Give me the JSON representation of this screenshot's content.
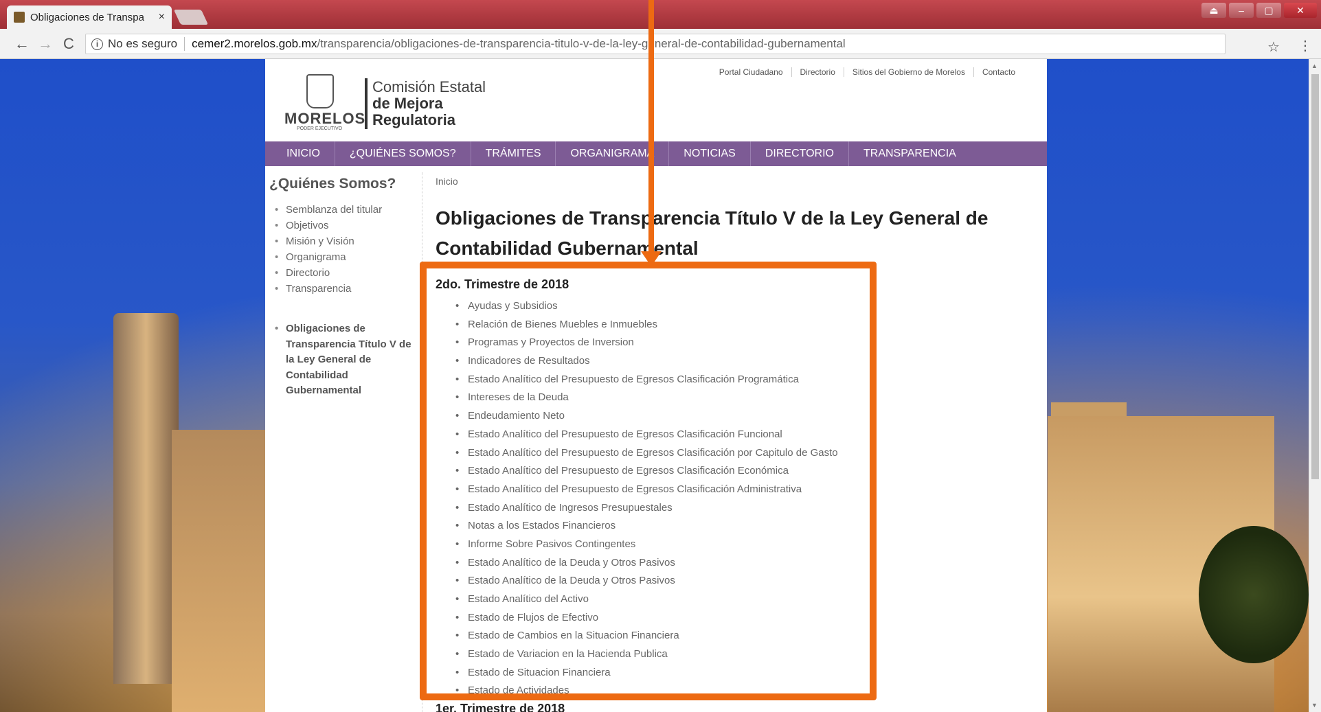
{
  "browser": {
    "tab_title": "Obligaciones de Transpa",
    "tab_close": "×",
    "window_buttons": [
      "⏏",
      "–",
      "▢",
      "✕"
    ],
    "nav": {
      "back": "←",
      "forward": "→",
      "reload": "C"
    },
    "security_label": "No es seguro",
    "url_domain": "cemer2.morelos.gob.mx",
    "url_path": "/transparencia/obligaciones-de-transparencia-titulo-v-de-la-ley-general-de-contabilidad-gubernamental",
    "star": "☆",
    "menu": "⋮"
  },
  "topnav": [
    "Portal Ciudadano",
    "Directorio",
    "Sitios del Gobierno de Morelos",
    "Contacto"
  ],
  "logo": {
    "morelos": "MORELOS",
    "poder": "PODER EJECUTIVO",
    "line1": "Comisión Estatal",
    "line2": "de Mejora",
    "line3": "Regulatoria"
  },
  "mainnav": [
    "INICIO",
    "¿QUIÉNES SOMOS?",
    "TRÁMITES",
    "ORGANIGRAMA",
    "NOTICIAS",
    "DIRECTORIO",
    "TRANSPARENCIA"
  ],
  "sidebar": {
    "title": "¿Quiénes Somos?",
    "items": [
      "Semblanza del titular",
      "Objetivos",
      "Misión y Visión",
      "Organigrama",
      "Directorio",
      "Transparencia"
    ],
    "active": "Obligaciones de Transparencia Título V de la Ley General de Contabilidad Gubernamental"
  },
  "content": {
    "breadcrumb": "Inicio",
    "heading": "Obligaciones de Transparencia Título V de la Ley General de Contabilidad Gubernamental",
    "section1_title": "2do. Trimestre de 2018",
    "section1_items": [
      "Ayudas y Subsidios",
      "Relación de Bienes Muebles e Inmuebles",
      "Programas y Proyectos de Inversion",
      "Indicadores de Resultados",
      "Estado Analítico del Presupuesto de Egresos Clasificación Programática",
      "Intereses de la Deuda",
      "Endeudamiento Neto",
      "Estado Analítico del Presupuesto de Egresos Clasificación Funcional",
      "Estado Analítico del Presupuesto de Egresos Clasificación por Capitulo de Gasto",
      "Estado Analítico del Presupuesto de Egresos Clasificación Económica",
      "Estado Analítico del Presupuesto de Egresos Clasificación Administrativa",
      "Estado Analítico de Ingresos Presupuestales",
      "Notas a los Estados Financieros",
      "Informe Sobre Pasivos Contingentes",
      "Estado Analítico de la Deuda y Otros Pasivos",
      "Estado Analítico de la Deuda y Otros Pasivos",
      "Estado Analítico del Activo",
      "Estado de Flujos de Efectivo",
      "Estado de Cambios en la Situacion Financiera",
      "Estado de Variacion en la Hacienda Publica",
      "Estado de Situacion Financiera",
      "Estado de Actividades"
    ],
    "section2_title": "1er. Trimestre de 2018"
  },
  "colors": {
    "nav_purple": "#7d5b95",
    "highlight": "#ed6a12"
  }
}
